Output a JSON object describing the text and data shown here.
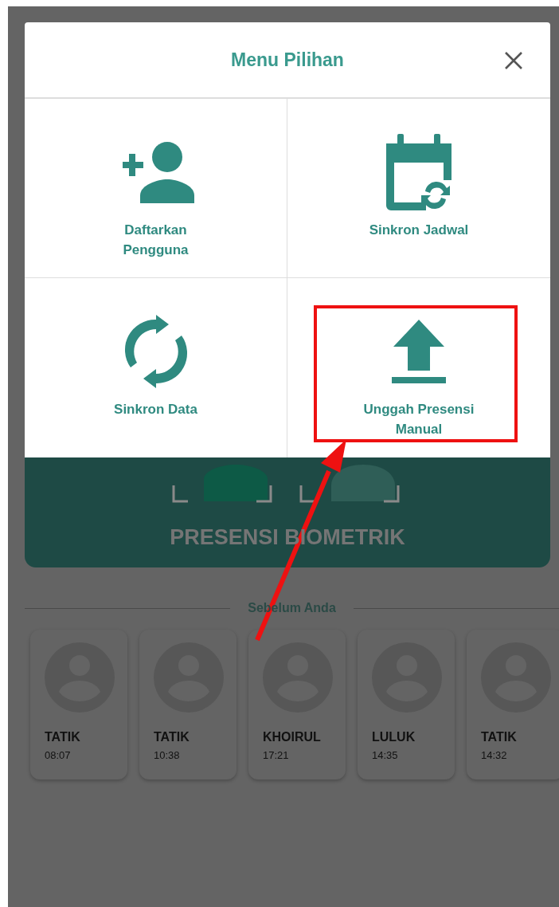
{
  "dialog": {
    "title": "Menu Pilihan",
    "options": [
      {
        "label": "Daftarkan\nPengguna",
        "kind": "add-user",
        "highlighted": false
      },
      {
        "label": "Sinkron Jadwal",
        "kind": "calendar-sync",
        "highlighted": false
      },
      {
        "label": "Sinkron Data",
        "kind": "sync",
        "highlighted": false
      },
      {
        "label": "Unggah Presensi\nManual",
        "kind": "upload",
        "highlighted": true
      }
    ]
  },
  "banner": {
    "title": "PRESENSI BIOMETRIK"
  },
  "recent": {
    "heading": "Sebelum Anda",
    "people": [
      {
        "name": "TATIK",
        "time": "08:07"
      },
      {
        "name": "TATIK",
        "time": "10:38"
      },
      {
        "name": "KHOIRUL",
        "time": "17:21"
      },
      {
        "name": "LULUK",
        "time": "14:35"
      },
      {
        "name": "TATIK",
        "time": "14:32"
      }
    ]
  }
}
